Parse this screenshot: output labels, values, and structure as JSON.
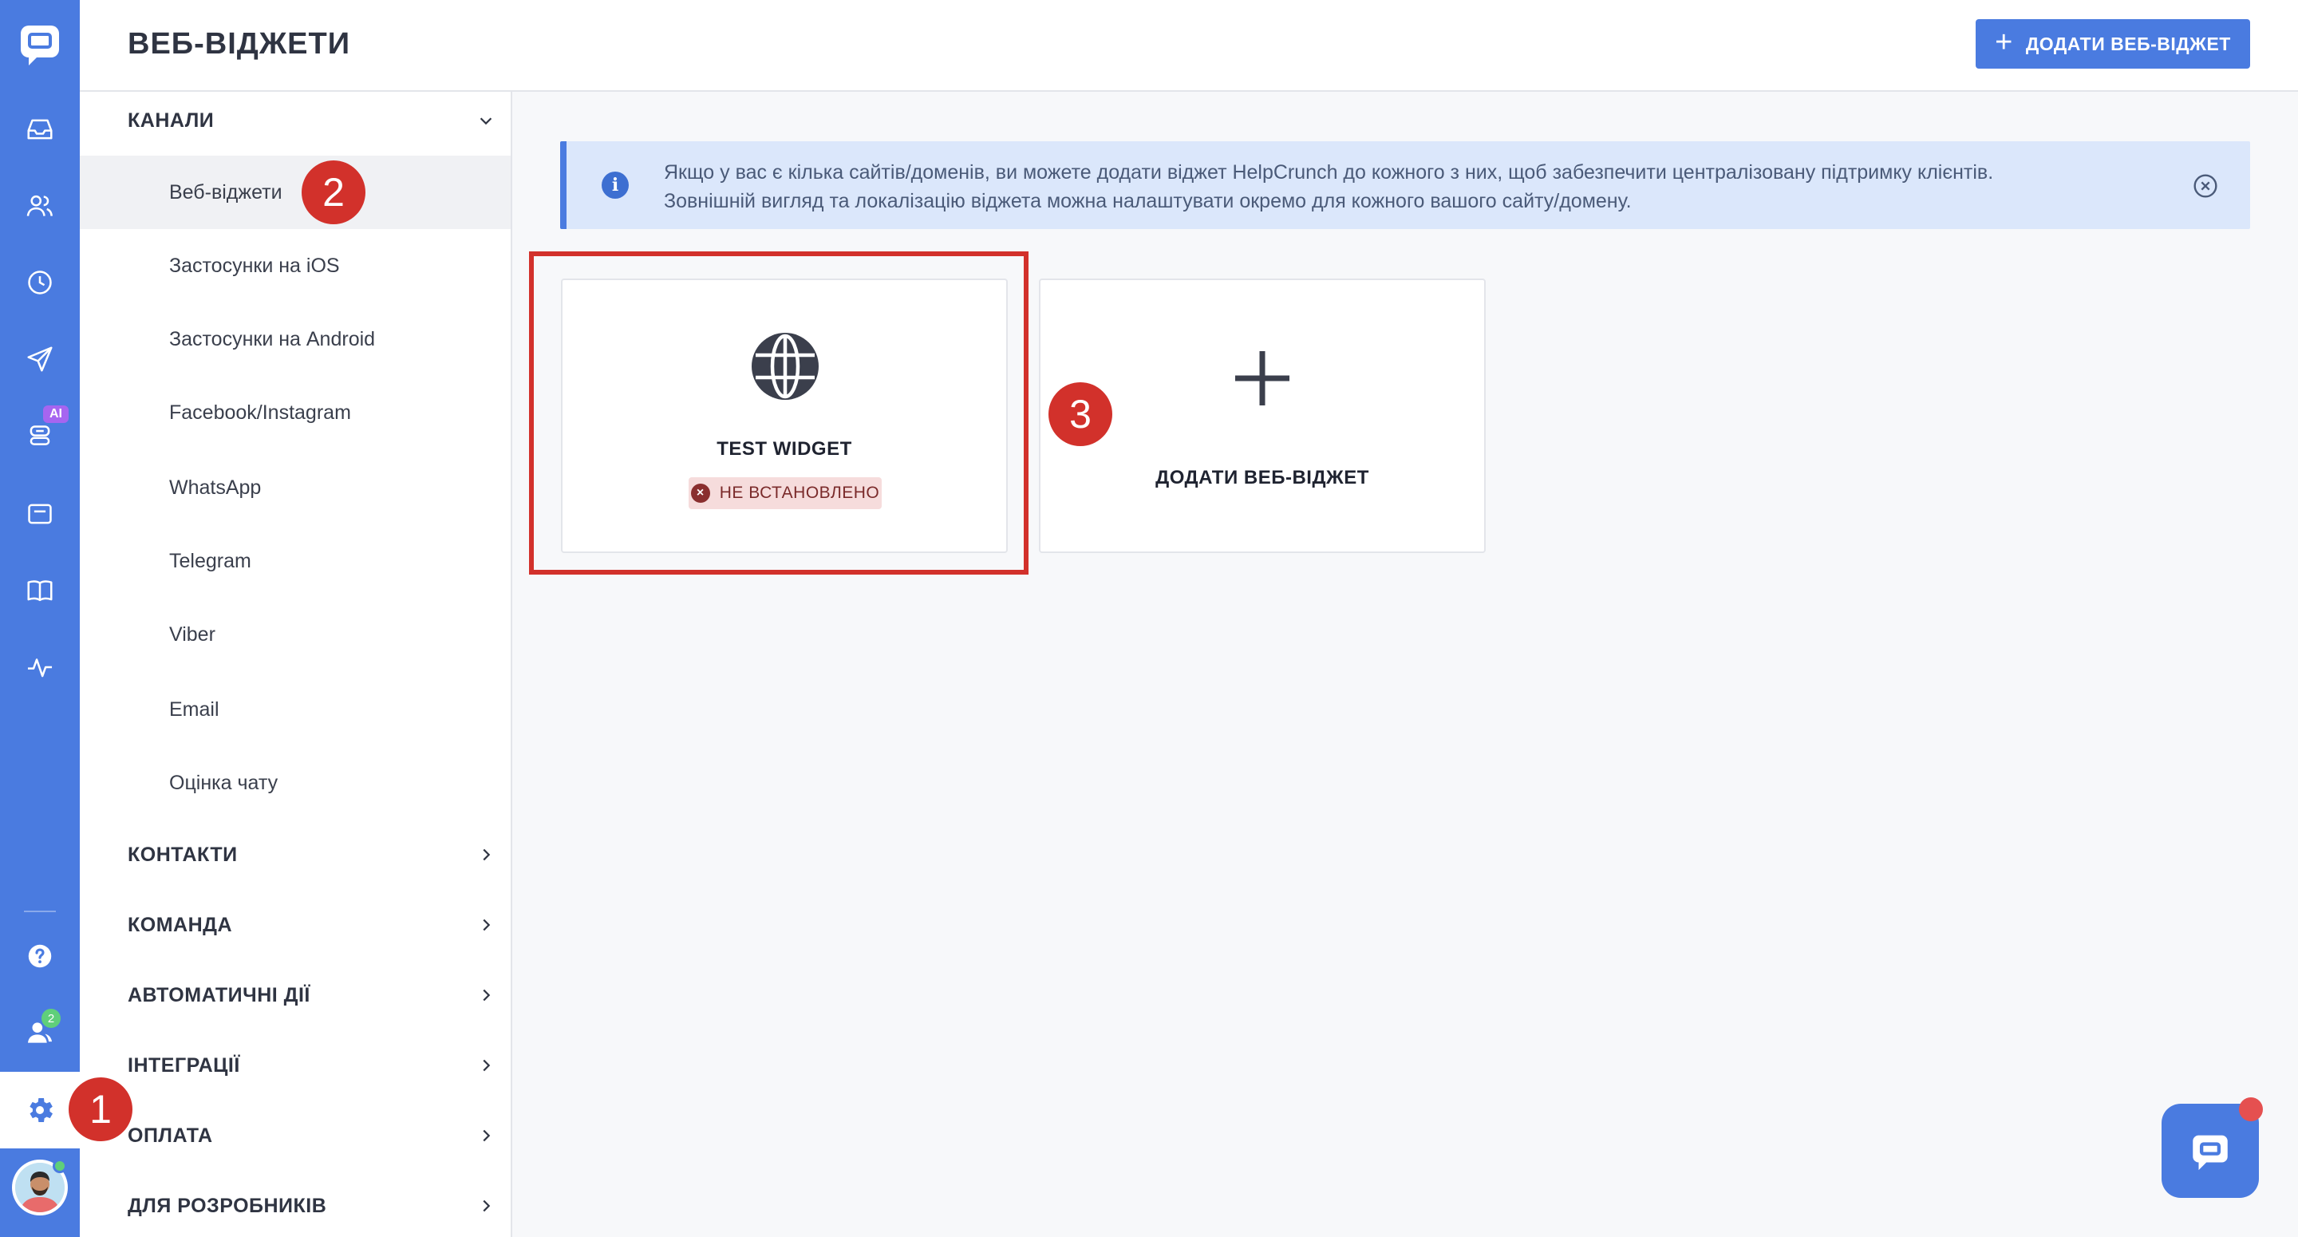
{
  "header": {
    "title": "ВЕБ-ВІДЖЕТИ",
    "add_button_label": "ДОДАТИ ВЕБ-ВІДЖЕТ"
  },
  "rail": {
    "ai_badge": "AI",
    "team_badge_count": "2"
  },
  "sidebar": {
    "channels": {
      "label": "КАНАЛИ",
      "items": [
        {
          "label": "Веб-віджети"
        },
        {
          "label": "Застосунки на iOS"
        },
        {
          "label": "Застосунки на Android"
        },
        {
          "label": "Facebook/Instagram"
        },
        {
          "label": "WhatsApp"
        },
        {
          "label": "Telegram"
        },
        {
          "label": "Viber"
        },
        {
          "label": "Email"
        },
        {
          "label": "Оцінка чату"
        }
      ]
    },
    "sections": [
      {
        "label": "КОНТАКТИ"
      },
      {
        "label": "КОМАНДА"
      },
      {
        "label": "АВТОМАТИЧНІ ДІЇ"
      },
      {
        "label": "ІНТЕГРАЦІЇ"
      },
      {
        "label": "ОПЛАТА"
      },
      {
        "label": "ДЛЯ РОЗРОБНИКІВ"
      }
    ]
  },
  "banner": {
    "line1": "Якщо у вас є кілька сайтів/доменів, ви можете додати віджет HelpCrunch до кожного з них, щоб забезпечити централізовану підтримку клієнтів.",
    "line2": "Зовнішній вигляд та локалізацію віджета можна налаштувати окремо для кожного вашого сайту/домену."
  },
  "widgets": [
    {
      "name": "TEST WIDGET",
      "status": "НЕ ВСТАНОВЛЕНО"
    }
  ],
  "add_card": {
    "label": "ДОДАТИ ВЕБ-ВІДЖЕТ"
  },
  "steps": {
    "one": "1",
    "two": "2",
    "three": "3"
  },
  "colors": {
    "brand": "#4a7be0",
    "marker": "#d2312b",
    "status_bg": "#f6dcdc",
    "banner_bg": "#dbe7fb"
  }
}
